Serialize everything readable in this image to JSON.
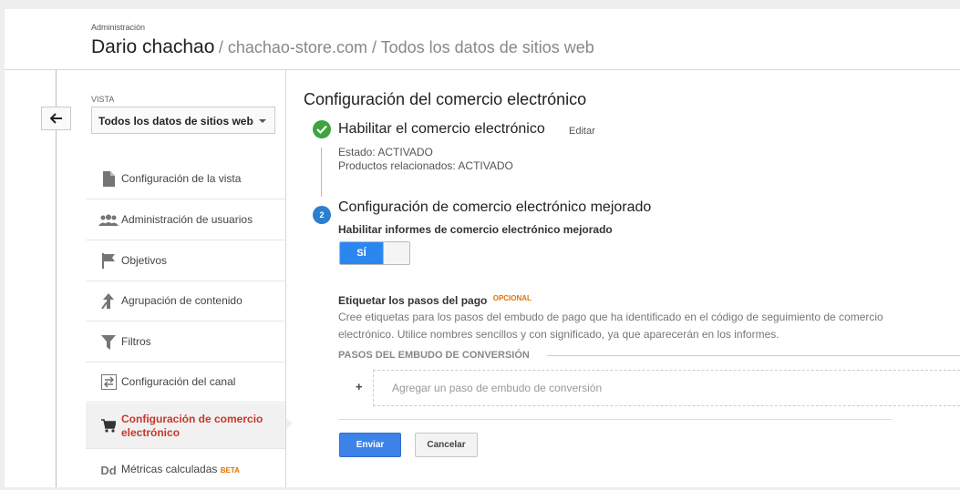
{
  "header": {
    "section_label": "Administración",
    "account": "Dario chachao",
    "path": "/ chachao-store.com / Todos los datos de sitios web"
  },
  "sidebar": {
    "vista_label": "VISTA",
    "vista_selected": "Todos los datos de sitios web",
    "items": [
      {
        "label": "Configuración de la vista",
        "icon": "document-icon"
      },
      {
        "label": "Administración de usuarios",
        "icon": "users-icon"
      },
      {
        "label": "Objetivos",
        "icon": "flag-icon"
      },
      {
        "label": "Agrupación de contenido",
        "icon": "content-group-icon"
      },
      {
        "label": "Filtros",
        "icon": "filter-icon"
      },
      {
        "label": "Configuración del canal",
        "icon": "channel-icon"
      },
      {
        "label": "Configuración de comercio electrónico",
        "icon": "cart-icon",
        "active": true
      },
      {
        "label": "Métricas calculadas",
        "icon": "dd-icon",
        "badge": "BETA"
      }
    ]
  },
  "main": {
    "title": "Configuración del comercio electrónico",
    "step1": {
      "title": "Habilitar el comercio electrónico",
      "edit_label": "Editar",
      "status": "Estado: ACTIVADO",
      "related": "Productos relacionados: ACTIVADO"
    },
    "step2": {
      "number": "2",
      "title": "Configuración de comercio electrónico mejorado",
      "enable_label": "Habilitar informes de comercio electrónico mejorado",
      "toggle_label": "SÍ",
      "toggle_on": true,
      "tag_label": "Etiquetar los pasos del pago",
      "optional_badge": "OPCIONAL",
      "description": "Cree etiquetas para los pasos del embudo de pago que ha identificado en el código de seguimiento de comercio electrónico. Utilice nombres sencillos y con significado, ya que aparecerán en los informes.",
      "funnel_header": "PASOS DEL EMBUDO DE CONVERSIÓN",
      "add_symbol": "+",
      "add_step_placeholder": "Agregar un paso de embudo de conversión"
    },
    "buttons": {
      "send": "Enviar",
      "cancel": "Cancelar"
    }
  },
  "colors": {
    "accent_blue": "#2b87f0",
    "active_red": "#c5392b",
    "check_green": "#3fa33f",
    "badge_orange": "#e37400"
  }
}
